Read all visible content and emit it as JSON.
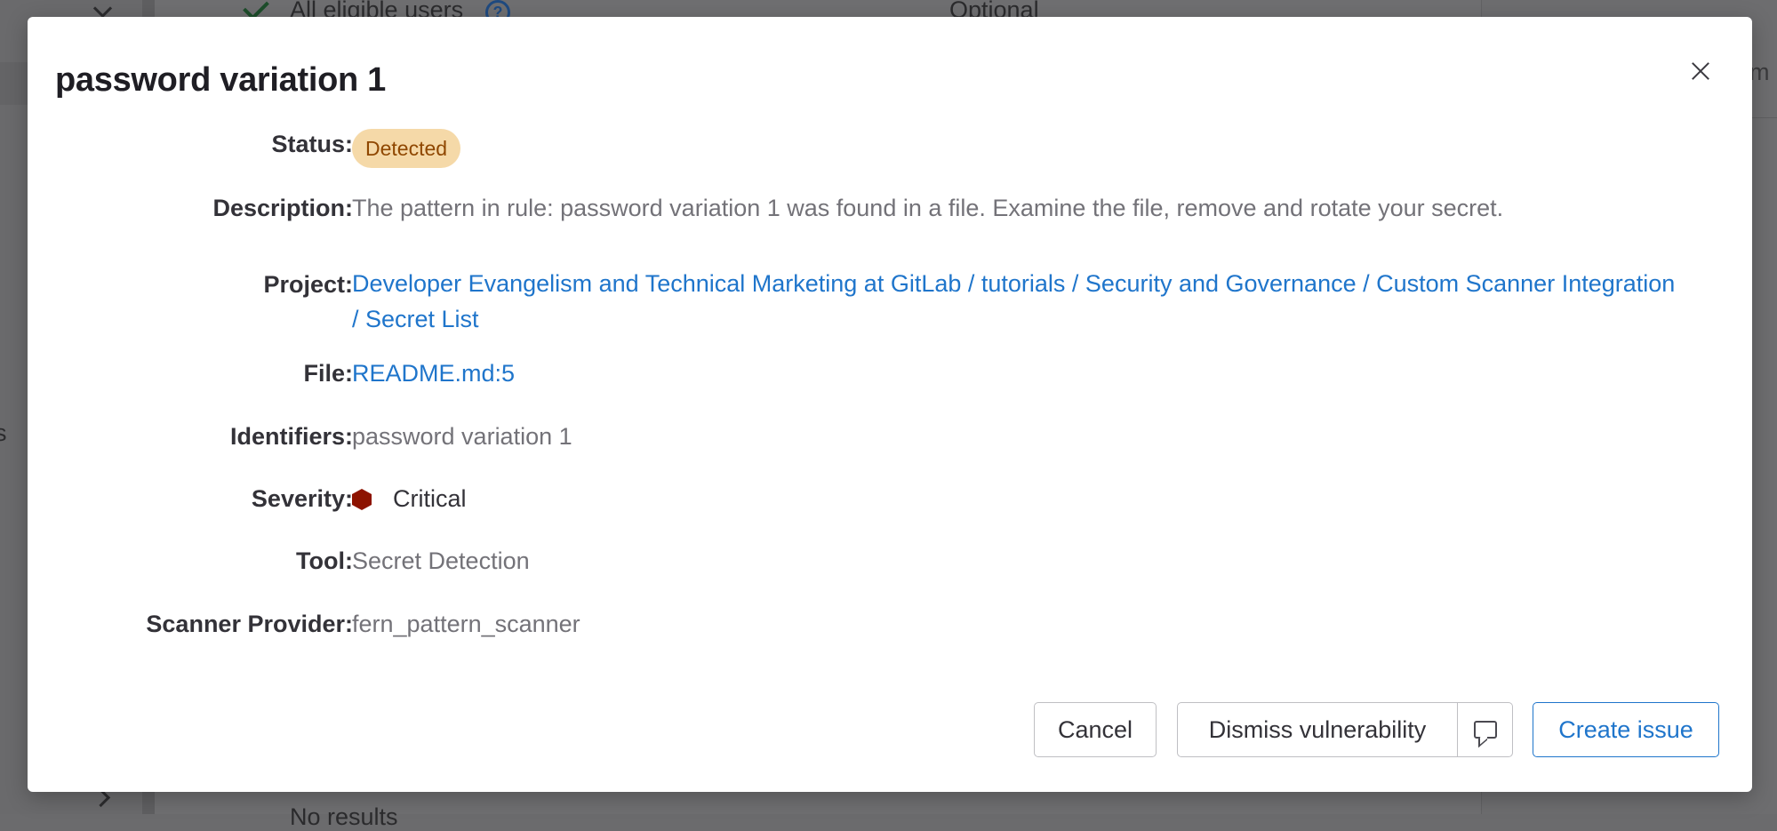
{
  "background": {
    "top_left_text": "All eligible users",
    "top_center_text": "Optional",
    "bottom_text": "No results",
    "right_partial_text": "im",
    "left_partial_text": "s"
  },
  "modal": {
    "title": "password variation 1",
    "fields": {
      "status": {
        "label": "Status:",
        "value": "Detected"
      },
      "description": {
        "label": "Description:",
        "value": "The pattern in rule: password variation 1 was found in a file. Examine the file, remove and rotate your secret."
      },
      "project": {
        "label": "Project:",
        "value": "Developer Evangelism and Technical Marketing at GitLab / tutorials / Security and Governance / Custom Scanner Integration / Secret List"
      },
      "file": {
        "label": "File:",
        "value": "README.md:5"
      },
      "identifiers": {
        "label": "Identifiers:",
        "value": "password variation 1"
      },
      "severity": {
        "label": "Severity:",
        "value": "Critical",
        "color": "#8d1300"
      },
      "tool": {
        "label": "Tool:",
        "value": "Secret Detection"
      },
      "scanner_provider": {
        "label": "Scanner Provider:",
        "value": "fern_pattern_scanner"
      }
    },
    "buttons": {
      "cancel": "Cancel",
      "dismiss": "Dismiss vulnerability",
      "create_issue": "Create issue"
    }
  },
  "colors": {
    "link": "#1f75cb",
    "badge_bg": "#f5d9a8",
    "badge_text": "#8f4700"
  }
}
